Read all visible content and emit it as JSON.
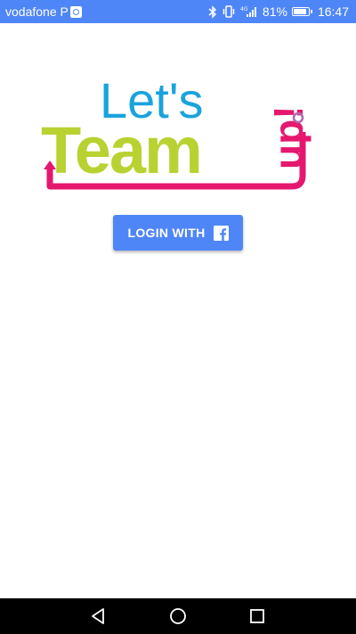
{
  "status_bar": {
    "carrier": "vodafone P",
    "battery": "81%",
    "time": "16:47",
    "network": "4G",
    "icons": [
      "sim-icon",
      "bluetooth-icon",
      "vibrate-icon",
      "signal-icon",
      "battery-icon"
    ]
  },
  "logo": {
    "line1": "Let's",
    "line2": "Team",
    "line3": "up!",
    "colors": {
      "lets": "#1aa3dc",
      "team": "#b9d232",
      "up": "#e5176f",
      "dot": "#b266b0"
    }
  },
  "login": {
    "label": "LOGIN WITH",
    "icon": "facebook-icon"
  },
  "nav_bar": {
    "icons": [
      "back-icon",
      "home-icon",
      "recents-icon"
    ]
  },
  "colors": {
    "accent": "#4f86f7",
    "background": "#ffffff",
    "nav": "#000000"
  }
}
